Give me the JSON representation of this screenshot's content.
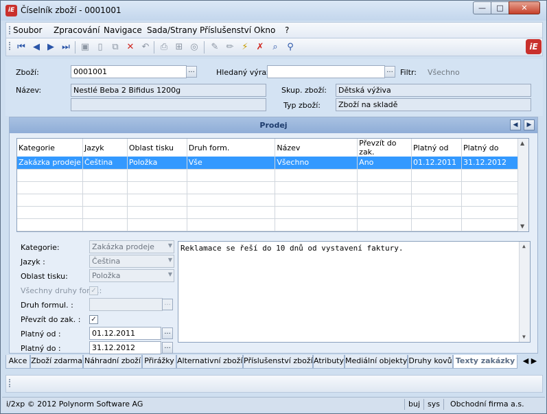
{
  "window": {
    "title": "Číselník zboží - 0001001",
    "app_icon_text": "iE",
    "min": "—",
    "max": "□",
    "close": "✕"
  },
  "menu": [
    "Soubor",
    "Zpracování",
    "Navigace",
    "Sada/Strany",
    "Příslušenství",
    "Okno",
    "?"
  ],
  "form": {
    "zbozi_label": "Zboží:",
    "zbozi_value": "0001001",
    "hledany_label": "Hledaný výraz:",
    "hledany_value": "",
    "filtr_label": "Filtr:",
    "filtr_value": "Všechno",
    "nazev_label": "Název:",
    "nazev_value": "Nestlé Beba 2 Bifidus 1200g",
    "nazev_value2": "",
    "skup_label": "Skup. zboží:",
    "skup_value": "Dětská výživa",
    "typ_label": "Typ zboží:",
    "typ_value": "Zboží na skladě",
    "ellipsis": "..."
  },
  "panel": {
    "title": "Prodej",
    "columns": [
      "Kategorie",
      "Jazyk",
      "Oblast tisku",
      "Druh form.",
      "Název",
      "Převzít do zak.",
      "Platný od",
      "Platný do"
    ],
    "rows": [
      [
        "Zakázka prodeje",
        "Čeština",
        "Položka",
        "Vše",
        "Všechno",
        "Ano",
        "01.12.2011",
        "31.12.2012"
      ]
    ]
  },
  "detail": {
    "kategorie_label": "Kategorie:",
    "kategorie_value": "Zakázka prodeje",
    "jazyk_label": "Jazyk  :",
    "jazyk_value": "Čeština",
    "oblast_label": "Oblast tisku:",
    "oblast_value": "Položka",
    "vsechny_label": "Všechny druhy form.:",
    "druh_label": "Druh formul. :",
    "druh_value": "",
    "prevzit_label": "Převzít do zak. :",
    "platny_od_label": "Platný od :",
    "platny_od_value": "01.12.2011",
    "platny_do_label": "Platný do :",
    "platny_do_value": "31.12.2012",
    "note_text": "Reklamace se řeší do 10 dnů od vystavení faktury."
  },
  "tabs": [
    "Akce",
    "Zboží zdarma",
    "Náhradní zboží",
    "Přirážky",
    "Alternativní zboží",
    "Příslušenství zboží",
    "Atributy",
    "Mediální objekty",
    "Druhy kovů",
    "Texty zakázky"
  ],
  "active_tab": "Texty zakázky",
  "status": {
    "copyright": "i/2xp © 2012 Polynorm Software AG",
    "user": "buj",
    "db": "sys",
    "company": "Obchodní firma a.s."
  }
}
